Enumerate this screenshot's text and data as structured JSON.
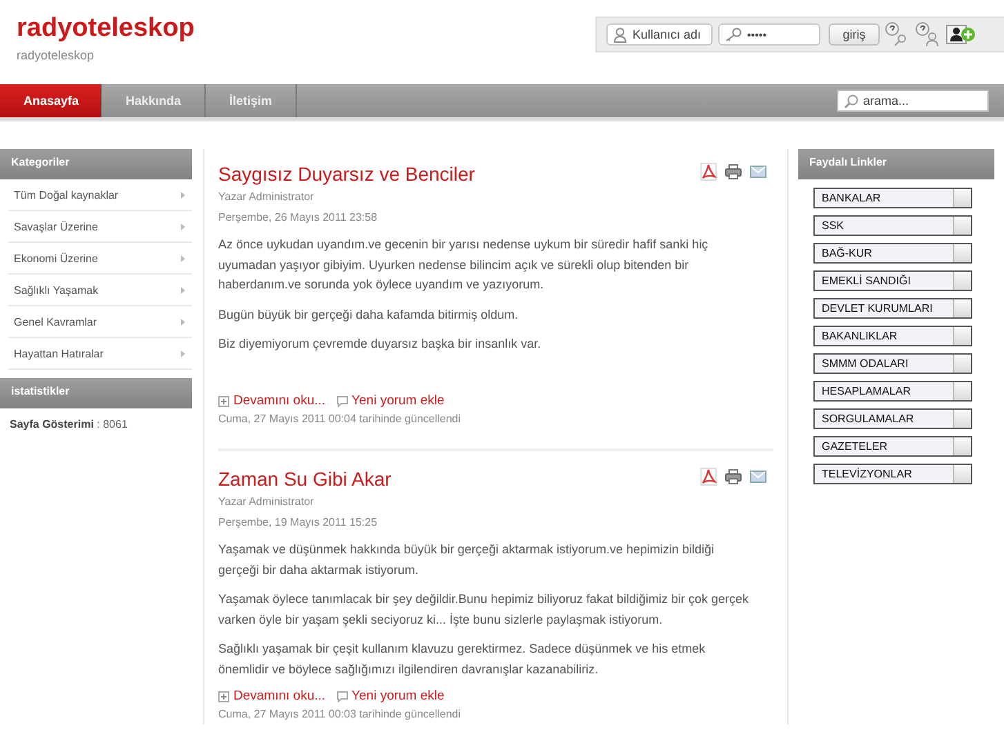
{
  "header": {
    "site_title": "radyoteleskop",
    "site_subtitle": "radyoteleskop"
  },
  "login": {
    "username_placeholder": "Kullanıcı adı",
    "password_value": "•••••",
    "submit": "giriş"
  },
  "nav": {
    "items": [
      {
        "label": "Anasayfa",
        "selected": true
      },
      {
        "label": "Hakkında",
        "selected": false
      },
      {
        "label": "İletişim",
        "selected": false
      }
    ],
    "search_placeholder": "arama..."
  },
  "categories": {
    "title": "Kategoriler",
    "items": [
      "Tüm Doğal kaynaklar",
      "Savaşlar Üzerine",
      "Ekonomi Üzerine",
      "Sağlıklı Yaşamak",
      "Genel Kavramlar",
      "Hayattan Hatıralar"
    ]
  },
  "statistics": {
    "title": "istatistikler",
    "text": "**Sayfa Gösterimi** : 8061"
  },
  "articles": [
    {
      "title": "Saygısız Duyarsız ve Benciler",
      "author": "Yazar Administrator",
      "date": "Perşembe, 26 Mayıs 2011 23:58",
      "paragraphs": [
        "Az önce uykudan uyandım.ve gecenin bir yarısı nedense uykum bir süredir hafif sanki hiç uyumadan yaşıyor gibiyim. Uyurken nedense bilincim açık ve sürekli olup bitenden bir haberdanım.ve sorunda yok öylece uyandım ve yazıyorum.",
        "Bugün büyük bir gerçeği daha kafamda bitirmiş oldum.",
        "Biz diyemiyorum çevremde duyarsız başka bir insanlık var."
      ],
      "read_more": "Devamını oku...",
      "add_comment": "Yeni yorum ekle",
      "updated": "Cuma, 27 Mayıs 2011 00:04 tarihinde güncellendi"
    },
    {
      "title": "Zaman Su Gibi Akar",
      "author": "Yazar Administrator",
      "date": "Perşembe, 19 Mayıs 2011 15:25",
      "paragraphs": [
        "Yaşamak ve düşünmek hakkında büyük bir gerçeği aktarmak istiyorum.ve hepimizin bildiği gerçeği bir daha aktarmak istiyorum.",
        "Yaşamak öylece tanımlacak bir şey değildir.Bunu hepimiz biliyoruz fakat bildiğimiz bir çok gerçek varken öyle bir yaşam şekli seciyoruz ki... İşte bunu sizlerle paylaşmak istiyorum.",
        "Sağlıklı yaşamak bir çeşit kullanım klavuzu gerektirmez. Sadece düşünmek ve his etmek önemlidir ve böylece sağlığımızı ilgilendiren davranışlar kazanabiliriz."
      ],
      "read_more": "Devamını oku...",
      "add_comment": "Yeni yorum ekle",
      "updated": "Cuma, 27 Mayıs 2011 00:03 tarihinde güncellendi"
    }
  ],
  "useful_links": {
    "title": "Faydalı Linkler",
    "items": [
      "BANKALAR",
      "SSK",
      "BAĞ-KUR",
      "EMEKLİ SANDIĞI",
      "DEVLET KURUMLARI",
      "BAKANLIKLAR",
      "SMMM ODALARI",
      "HESAPLAMALAR",
      "SORGULAMALAR",
      "GAZETELER",
      "TELEVİZYONLAR"
    ]
  }
}
